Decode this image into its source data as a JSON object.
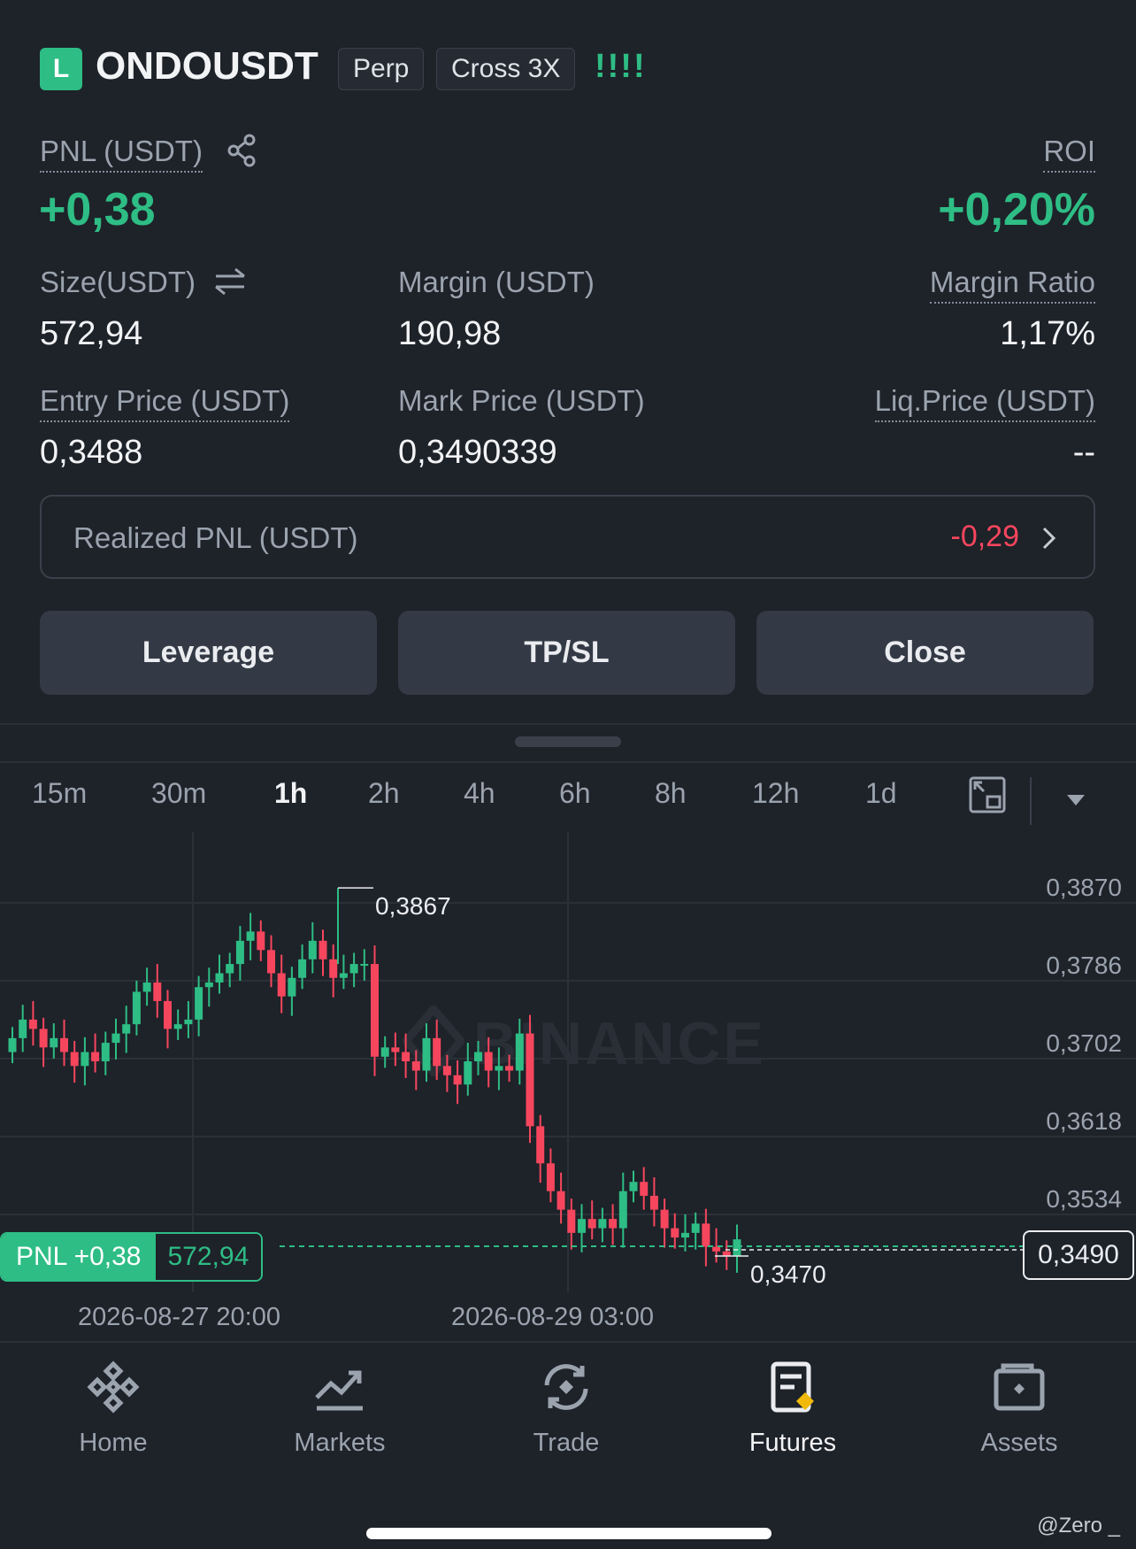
{
  "header": {
    "side_badge": "L",
    "symbol": "ONDOUSDT",
    "tag_perp": "Perp",
    "tag_margin": "Cross 3X",
    "signal": "!!!!"
  },
  "pnl": {
    "label": "PNL (USDT)",
    "value": "+0,38",
    "roi_label": "ROI",
    "roi_value": "+0,20%"
  },
  "stats": {
    "size_label": "Size(USDT)",
    "size_value": "572,94",
    "margin_label": "Margin (USDT)",
    "margin_value": "190,98",
    "margin_ratio_label": "Margin Ratio",
    "margin_ratio_value": "1,17%",
    "entry_label": "Entry Price (USDT)",
    "entry_value": "0,3488",
    "mark_label": "Mark Price (USDT)",
    "mark_value": "0,3490339",
    "liq_label": "Liq.Price (USDT)",
    "liq_value": "--"
  },
  "realized": {
    "label": "Realized PNL (USDT)",
    "value": "-0,29"
  },
  "actions": {
    "leverage": "Leverage",
    "tpsl": "TP/SL",
    "close": "Close"
  },
  "timeframes": [
    "15m",
    "30m",
    "1h",
    "2h",
    "4h",
    "6h",
    "8h",
    "12h",
    "1d"
  ],
  "selected_timeframe": "1h",
  "chart": {
    "y_ticks": [
      "0,3870",
      "0,3786",
      "0,3702",
      "0,3618",
      "0,3534"
    ],
    "high_label": "0,3867",
    "low_label": "0,3470",
    "current_price": "0,3490",
    "pnl_tag": "PNL +0,38",
    "size_tag": "572,94",
    "x_ticks": [
      "2026-08-27 20:00",
      "2026-08-29 03:00"
    ],
    "watermark": "BINANCE"
  },
  "colors": {
    "up": "#2ebd85",
    "down": "#f6465d",
    "accent": "#f0b90b",
    "bg": "#1e2229"
  },
  "nav": [
    {
      "label": "Home",
      "icon": "home-diamond-icon"
    },
    {
      "label": "Markets",
      "icon": "markets-chart-icon"
    },
    {
      "label": "Trade",
      "icon": "trade-swap-icon"
    },
    {
      "label": "Futures",
      "icon": "futures-doc-icon"
    },
    {
      "label": "Assets",
      "icon": "assets-wallet-icon"
    }
  ],
  "footer": {
    "credit": "@Zero _"
  }
}
